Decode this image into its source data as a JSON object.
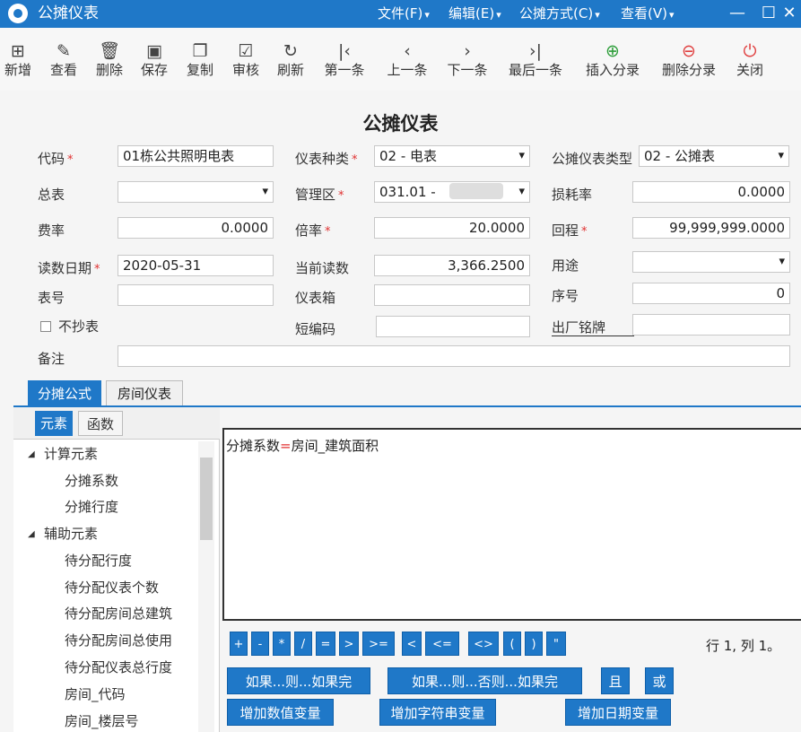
{
  "window": {
    "title": "公摊仪表"
  },
  "menu": {
    "file": "文件(F)",
    "edit": "编辑(E)",
    "allocation": "公摊方式(C)",
    "view": "查看(V)"
  },
  "window_controls": {
    "minimize": "—",
    "maximize": "☐",
    "close": "✕"
  },
  "toolbar": [
    {
      "label": "新增",
      "icon": "add-icon",
      "glyph": "⊞"
    },
    {
      "label": "查看",
      "icon": "edit-icon",
      "glyph": "✎"
    },
    {
      "label": "删除",
      "icon": "delete-icon",
      "glyph": "🗑"
    },
    {
      "label": "保存",
      "icon": "save-icon",
      "glyph": "▣"
    },
    {
      "label": "复制",
      "icon": "copy-icon",
      "glyph": "❐"
    },
    {
      "label": "审核",
      "icon": "approve-icon",
      "glyph": "☑"
    },
    {
      "label": "刷新",
      "icon": "refresh-icon",
      "glyph": "↻"
    },
    {
      "label": "第一条",
      "icon": "first-icon",
      "glyph": "|‹"
    },
    {
      "label": "上一条",
      "icon": "prev-icon",
      "glyph": "‹"
    },
    {
      "label": "下一条",
      "icon": "next-icon",
      "glyph": "›"
    },
    {
      "label": "最后一条",
      "icon": "last-icon",
      "glyph": "›|"
    },
    {
      "label": "插入分录",
      "icon": "insert-row-icon",
      "glyph": "⊕",
      "color": "#2e9e3a"
    },
    {
      "label": "删除分录",
      "icon": "delete-row-icon",
      "glyph": "⊖",
      "color": "#e04040"
    },
    {
      "label": "关闭",
      "icon": "power-icon",
      "glyph": "⏻",
      "color": "#e04040"
    }
  ],
  "form": {
    "title": "公摊仪表",
    "required_mark": "*",
    "code": {
      "label": "代码",
      "value": "01栋公共照明电表"
    },
    "meter_kind": {
      "label": "仪表种类",
      "value": "02 - 电表"
    },
    "meter_type": {
      "label": "公摊仪表类型",
      "value": "02 - 公摊表"
    },
    "master_meter": {
      "label": "总表",
      "value": ""
    },
    "management_area": {
      "label": "管理区",
      "value": "031.01 - "
    },
    "loss_rate": {
      "label": "损耗率",
      "value": "0.0000"
    },
    "rate": {
      "label": "费率",
      "value": "0.0000"
    },
    "multiplier": {
      "label": "倍率",
      "value": "20.0000"
    },
    "range": {
      "label": "回程",
      "value": "99,999,999.0000"
    },
    "read_date": {
      "label": "读数日期",
      "value": "2020-05-31"
    },
    "current_reading": {
      "label": "当前读数",
      "value": "3,366.2500"
    },
    "usage": {
      "label": "用途",
      "value": ""
    },
    "meter_no": {
      "label": "表号",
      "value": ""
    },
    "meter_box": {
      "label": "仪表箱",
      "value": ""
    },
    "seq_no": {
      "label": "序号",
      "value": "0"
    },
    "no_reading": {
      "label": "不抄表",
      "checked": false
    },
    "short_code": {
      "label": "短编码",
      "value": ""
    },
    "nameplate": {
      "label": "出厂铭牌",
      "value": ""
    },
    "remarks": {
      "label": "备注",
      "value": ""
    }
  },
  "tabs": {
    "formula": "分摊公式",
    "room_meter": "房间仪表"
  },
  "subtabs": {
    "elements": "元素",
    "functions": "函数"
  },
  "tree": [
    {
      "label": "计算元素",
      "level": 0
    },
    {
      "label": "分摊系数",
      "level": 1
    },
    {
      "label": "分摊行度",
      "level": 1
    },
    {
      "label": "辅助元素",
      "level": 0
    },
    {
      "label": "待分配行度",
      "level": 1
    },
    {
      "label": "待分配仪表个数",
      "level": 1
    },
    {
      "label": "待分配房间总建筑",
      "level": 1
    },
    {
      "label": "待分配房间总使用",
      "level": 1
    },
    {
      "label": "待分配仪表总行度",
      "level": 1
    },
    {
      "label": "房间_代码",
      "level": 1
    },
    {
      "label": "房间_楼层号",
      "level": 1
    }
  ],
  "editor": {
    "lhs": "分摊系数",
    "op": "=",
    "rhs": "房间_建筑面积"
  },
  "operators": [
    "+",
    "-",
    "*",
    "/",
    "=",
    ">",
    ">=",
    "<",
    "<=",
    "<>",
    "(",
    ")",
    "\""
  ],
  "cursor_position": "行 1, 列 1。",
  "buttons": {
    "if_then": "如果...则...如果完",
    "if_then_else": "如果...则...否则...如果完",
    "and": "且",
    "or": "或",
    "add_numeric_var": "增加数值变量",
    "add_string_var": "增加字符串变量",
    "add_date_var": "增加日期变量"
  },
  "colors": {
    "accent": "#1f78c8",
    "required": "#e03030"
  }
}
